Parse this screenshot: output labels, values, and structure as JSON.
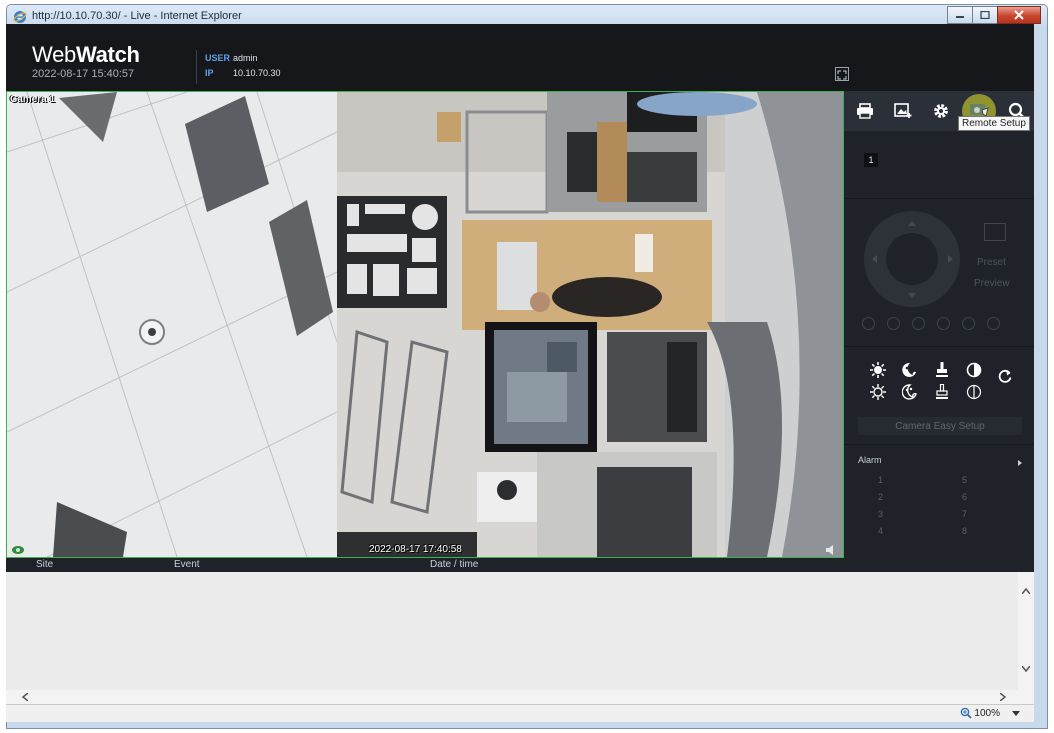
{
  "window": {
    "title": "http://10.10.70.30/ - Live - Internet Explorer"
  },
  "header": {
    "logo_regular": "Web",
    "logo_bold": "Watch",
    "datetime": "2022-08-17 15:40:57",
    "user_label": "USER",
    "user_value": "admin",
    "ip_label": "IP",
    "ip_value": "10.10.70.30"
  },
  "camera": {
    "label": "Camera 1",
    "timestamp": "2022-08-17 17:40:58"
  },
  "toolbar": {
    "items": [
      "print-icon",
      "snapshot-icon",
      "settings-icon",
      "remote-setup-icon",
      "search-icon"
    ],
    "tooltip": "Remote Setup",
    "active_color": "#9c9e2f"
  },
  "panel": {
    "channel": "1",
    "preset_label": "Preset",
    "preview_label": "Preview",
    "easy_setup_label": "Camera Easy Setup",
    "alarm_title": "Alarm",
    "alarm_items": [
      "1",
      "2",
      "3",
      "4",
      "5",
      "6",
      "7",
      "8"
    ]
  },
  "events": {
    "columns": [
      "Site",
      "Event",
      "Date / time"
    ]
  },
  "statusbar": {
    "zoom": "100%"
  },
  "colors": {
    "header_bg": "#15171b",
    "panel_bg": "#1f2329",
    "camera_border": "#3ab34a",
    "accent_blue": "#5fa2e6"
  }
}
